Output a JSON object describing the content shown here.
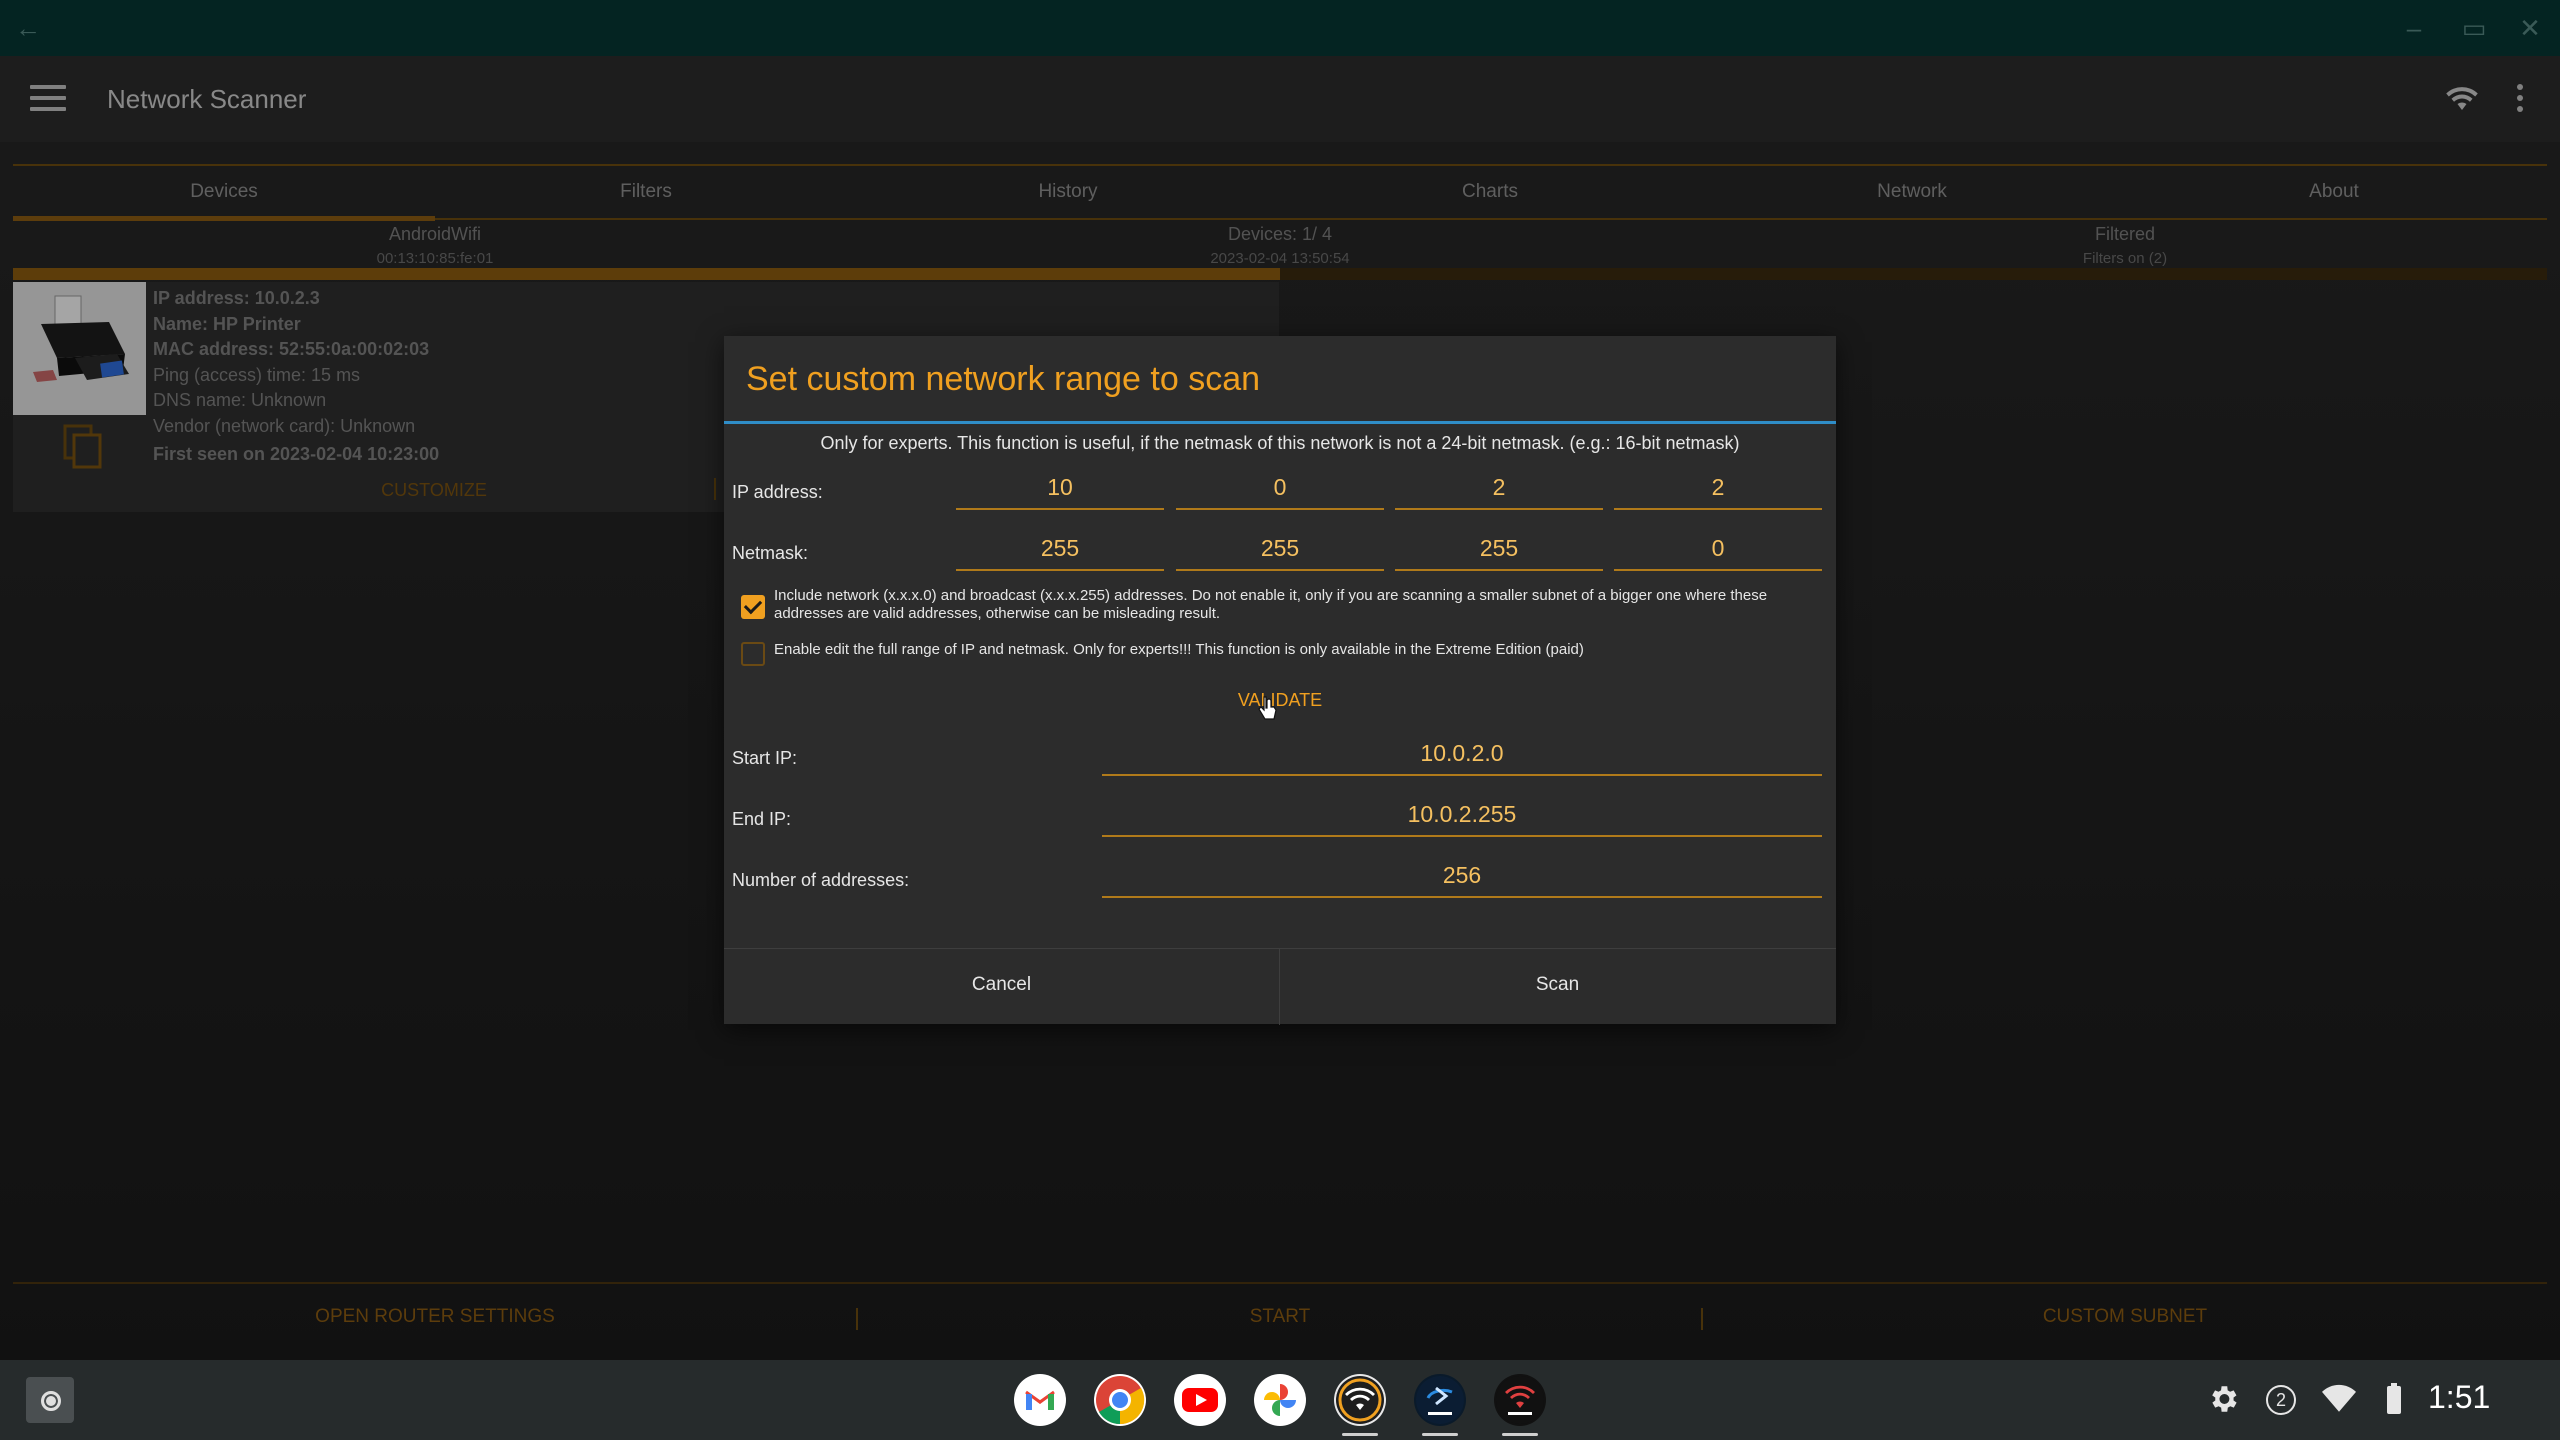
{
  "app": {
    "title": "Network Scanner"
  },
  "tabs": [
    "Devices",
    "Filters",
    "History",
    "Charts",
    "Network",
    "About"
  ],
  "status": {
    "network_name": "AndroidWifi",
    "network_mac": "00:13:10:85:fe:01",
    "devices_count": "Devices: 1/ 4",
    "scan_time": "2023-02-04 13:50:54",
    "filter_state": "Filtered",
    "filters_on": "Filters on (2)",
    "progress_fraction": 0.5
  },
  "device": {
    "ip": "IP address: 10.0.2.3",
    "name": "Name: HP Printer",
    "mac": "MAC address: 52:55:0a:00:02:03",
    "ping": "Ping (access) time: 15  ms",
    "dns": "DNS name: Unknown",
    "vendor": "Vendor (network card): Unknown",
    "first_seen": "First seen on 2023-02-04 10:23:00",
    "customize_label": "CUSTOMIZE"
  },
  "bottom_bar": {
    "router_label": "OPEN ROUTER SETTINGS",
    "start_label": "START",
    "subnet_label": "CUSTOM SUBNET"
  },
  "dialog": {
    "title": "Set custom network range to scan",
    "note": "Only for experts. This function is useful, if the netmask of this network is not a 24-bit netmask. (e.g.: 16-bit netmask)",
    "ip_label": "IP address:",
    "ip_octets": [
      "10",
      "0",
      "2",
      "2"
    ],
    "netmask_label": "Netmask:",
    "netmask_octets": [
      "255",
      "255",
      "255",
      "0"
    ],
    "include_checkbox": {
      "checked": true,
      "text": "Include network (x.x.x.0) and broadcast (x.x.x.255) addresses. Do not enable it, only if you are scanning a smaller subnet of a bigger one where these addresses are valid addresses, otherwise can be misleading result."
    },
    "fullrange_checkbox": {
      "checked": false,
      "text": "Enable edit the full range of IP and netmask. Only for experts!!! This function is only available in the Extreme Edition (paid)"
    },
    "validate_label": "VALIDATE",
    "start_ip_label": "Start IP:",
    "start_ip": "10.0.2.0",
    "end_ip_label": "End IP:",
    "end_ip": "10.0.2.255",
    "count_label": "Number of addresses:",
    "count": "256",
    "cancel_label": "Cancel",
    "scan_label": "Scan"
  },
  "shelf": {
    "apps": [
      "gmail-icon",
      "chrome-icon",
      "youtube-icon",
      "photos-icon",
      "wifi-analyzer-icon",
      "discover-icon",
      "network-discover-icon"
    ],
    "notification_count": "2",
    "time": "1:51"
  },
  "colors": {
    "accent": "#f0a020",
    "dialog_divider": "#2f8dc7",
    "caption_bar": "#042422"
  }
}
